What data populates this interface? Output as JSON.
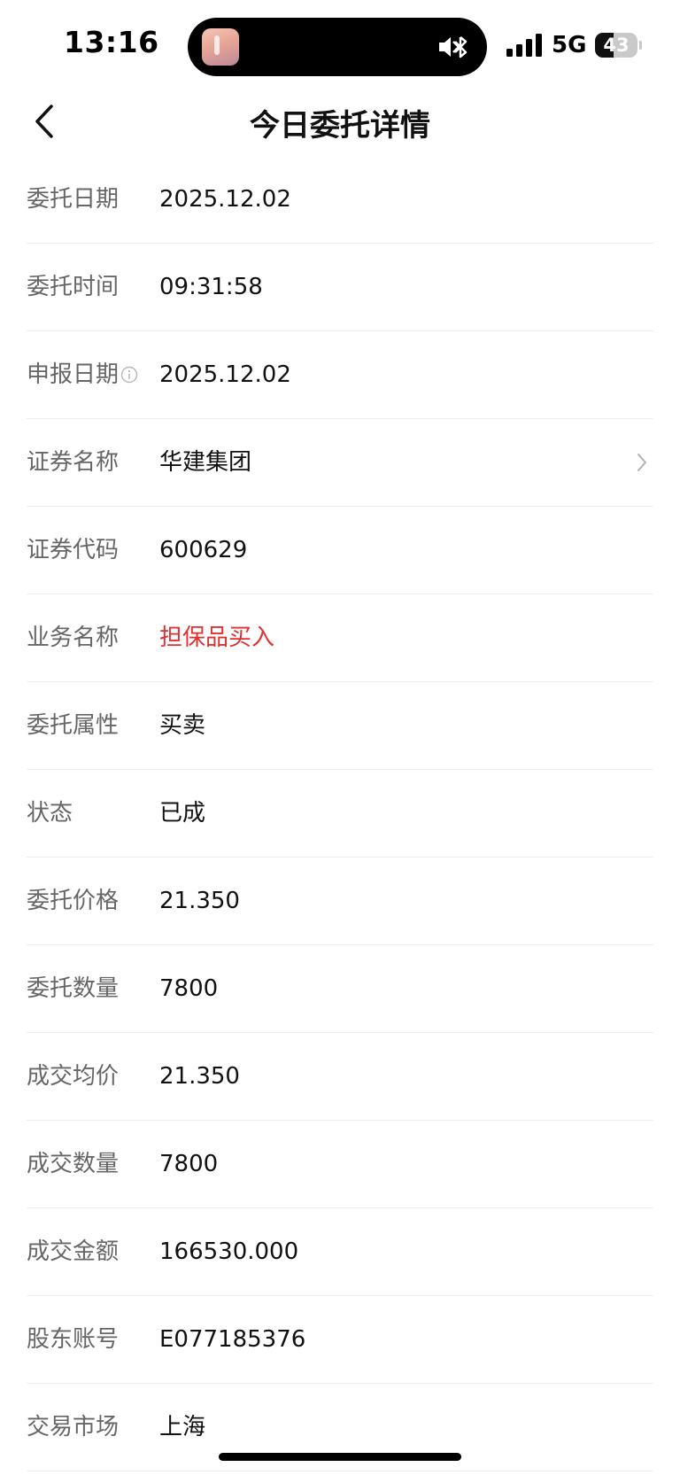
{
  "status_bar": {
    "time": "13:16",
    "network": "5G",
    "battery_level": "43",
    "battery_fraction": 0.43,
    "island_icons": [
      "app-thumbnail-icon",
      "mute-bluetooth-icon"
    ]
  },
  "nav": {
    "title": "今日委托详情",
    "back_icon": "chevron-left-icon"
  },
  "details": [
    {
      "label": "委托日期",
      "value": "2025.12.02"
    },
    {
      "label": "委托时间",
      "value": "09:31:58"
    },
    {
      "label": "申报日期",
      "value": "2025.12.02",
      "info_icon": "info-icon"
    },
    {
      "label": "证券名称",
      "value": "华建集团",
      "chevron": "chevron-right-icon"
    },
    {
      "label": "证券代码",
      "value": "600629"
    },
    {
      "label": "业务名称",
      "value": "担保品买入",
      "value_color": "#e03030"
    },
    {
      "label": "委托属性",
      "value": "买卖"
    },
    {
      "label": "状态",
      "value": "已成"
    },
    {
      "label": "委托价格",
      "value": "21.350"
    },
    {
      "label": "委托数量",
      "value": "7800"
    },
    {
      "label": "成交均价",
      "value": "21.350"
    },
    {
      "label": "成交数量",
      "value": "7800"
    },
    {
      "label": "成交金额",
      "value": "166530.000"
    },
    {
      "label": "股东账号",
      "value": "E077185376"
    },
    {
      "label": "交易市场",
      "value": "上海"
    }
  ],
  "colors": {
    "label": "#666666",
    "value": "#111111",
    "accent_red": "#e03030",
    "divider": "#eeeeee"
  }
}
